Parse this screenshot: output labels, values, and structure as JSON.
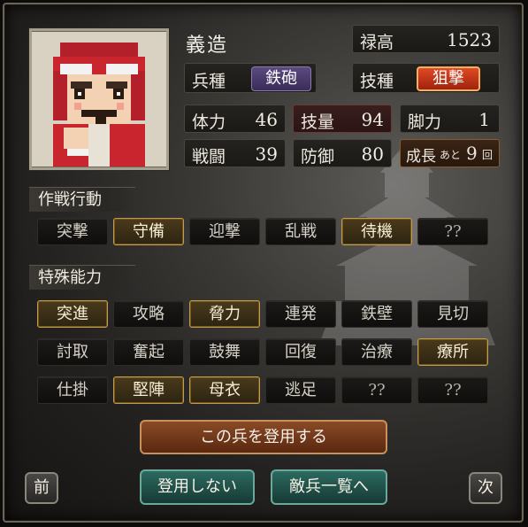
{
  "unit": {
    "name": "義造",
    "stipend": {
      "label": "禄高",
      "value": "1523"
    },
    "unit_type": {
      "label": "兵種",
      "value": "鉄砲"
    },
    "skill": {
      "label": "技種",
      "value": "狙撃"
    },
    "stats": {
      "hp": {
        "label": "体力",
        "value": "46"
      },
      "technique": {
        "label": "技量",
        "value": "94"
      },
      "leg": {
        "label": "脚力",
        "value": "1"
      },
      "combat": {
        "label": "戦闘",
        "value": "39"
      },
      "defense": {
        "label": "防御",
        "value": "80"
      }
    },
    "growth": {
      "label": "成長",
      "ato": "あと",
      "value": "9",
      "unit": "回"
    }
  },
  "tactics": {
    "heading": "作戦行動",
    "buttons": [
      {
        "label": "突撃",
        "active": false
      },
      {
        "label": "守備",
        "active": true
      },
      {
        "label": "迎撃",
        "active": false
      },
      {
        "label": "乱戦",
        "active": false
      },
      {
        "label": "待機",
        "active": true
      },
      {
        "label": "??",
        "active": false
      }
    ]
  },
  "abilities": {
    "heading": "特殊能力",
    "rows": [
      [
        {
          "label": "突進",
          "active": true
        },
        {
          "label": "攻略",
          "active": false
        },
        {
          "label": "脅力",
          "active": true
        },
        {
          "label": "連発",
          "active": false
        },
        {
          "label": "鉄壁",
          "active": false
        },
        {
          "label": "見切",
          "active": false
        }
      ],
      [
        {
          "label": "討取",
          "active": false
        },
        {
          "label": "奮起",
          "active": false
        },
        {
          "label": "鼓舞",
          "active": false
        },
        {
          "label": "回復",
          "active": false
        },
        {
          "label": "治療",
          "active": false
        },
        {
          "label": "療所",
          "active": true
        }
      ],
      [
        {
          "label": "仕掛",
          "active": false
        },
        {
          "label": "堅陣",
          "active": true
        },
        {
          "label": "母衣",
          "active": true
        },
        {
          "label": "逃足",
          "active": false
        },
        {
          "label": "??",
          "active": false
        },
        {
          "label": "??",
          "active": false
        }
      ]
    ]
  },
  "actions": {
    "recruit": "この兵を登用する",
    "prev": "前",
    "no_recruit": "登用しない",
    "enemy_list": "敵兵一覧へ",
    "next": "次"
  },
  "colors": {
    "active_border": "#c59b45",
    "musket_badge": "#4a3a6a",
    "snipe_badge": "#c4361c",
    "recruit_button": "#7a3a1c",
    "teal_button": "#1f4f48"
  }
}
